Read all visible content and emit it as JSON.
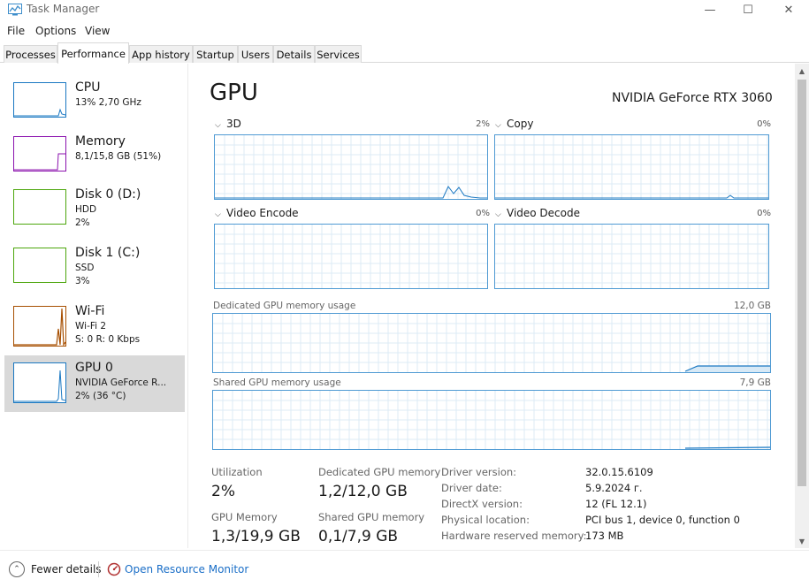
{
  "window": {
    "title": "Task Manager",
    "app_icon": "task-manager-icon",
    "controls": {
      "minimize": "—",
      "maximize": "☐",
      "close": "✕"
    }
  },
  "menu": [
    "File",
    "Options",
    "View"
  ],
  "tabs": [
    "Processes",
    "Performance",
    "App history",
    "Startup",
    "Users",
    "Details",
    "Services"
  ],
  "active_tab": "Performance",
  "sidebar": {
    "items": [
      {
        "title": "CPU",
        "line1": "13% 2,70 GHz",
        "line2": "",
        "color": "#1a78c2"
      },
      {
        "title": "Memory",
        "line1": "8,1/15,8 GB (51%)",
        "line2": "",
        "color": "#8b12ae"
      },
      {
        "title": "Disk 0 (D:)",
        "line1": "HDD",
        "line2": "2%",
        "color": "#4da60c"
      },
      {
        "title": "Disk 1 (C:)",
        "line1": "SSD",
        "line2": "3%",
        "color": "#4da60c"
      },
      {
        "title": "Wi-Fi",
        "line1": "Wi-Fi 2",
        "line2": "S: 0 R: 0 Kbps",
        "color": "#a74f01"
      },
      {
        "title": "GPU 0",
        "line1": "NVIDIA GeForce R...",
        "line2": "2% (36 °C)",
        "color": "#1a78c2"
      }
    ],
    "selected_index": 5
  },
  "main": {
    "title": "GPU",
    "model": "NVIDIA GeForce RTX 3060",
    "graphs": [
      {
        "label": "3D",
        "value": "2%"
      },
      {
        "label": "Copy",
        "value": "0%"
      },
      {
        "label": "Video Encode",
        "value": "0%"
      },
      {
        "label": "Video Decode",
        "value": "0%"
      }
    ],
    "dedicated_memory": {
      "label": "Dedicated GPU memory usage",
      "max": "12,0 GB"
    },
    "shared_memory": {
      "label": "Shared GPU memory usage",
      "max": "7,9 GB"
    },
    "stats": {
      "utilization_label": "Utilization",
      "utilization_value": "2%",
      "gpu_memory_label": "GPU Memory",
      "gpu_memory_value": "1,3/19,9 GB",
      "dedicated_label": "Dedicated GPU memory",
      "dedicated_value": "1,2/12,0 GB",
      "shared_label": "Shared GPU memory",
      "shared_value": "0,1/7,9 GB"
    },
    "info": [
      {
        "key": "Driver version:",
        "value": "32.0.15.6109"
      },
      {
        "key": "Driver date:",
        "value": "5.9.2024 г."
      },
      {
        "key": "DirectX version:",
        "value": "12 (FL 12.1)"
      },
      {
        "key": "Physical location:",
        "value": "PCI bus 1, device 0, function 0"
      },
      {
        "key": "Hardware reserved memory:",
        "value": "173 MB"
      }
    ]
  },
  "footer": {
    "fewer_details": "Fewer details",
    "open_resource_monitor": "Open Resource Monitor"
  },
  "colors": {
    "graph_border": "#4f9ad3",
    "selected_bg": "#d9d9d9",
    "link": "#1a6ec7"
  }
}
